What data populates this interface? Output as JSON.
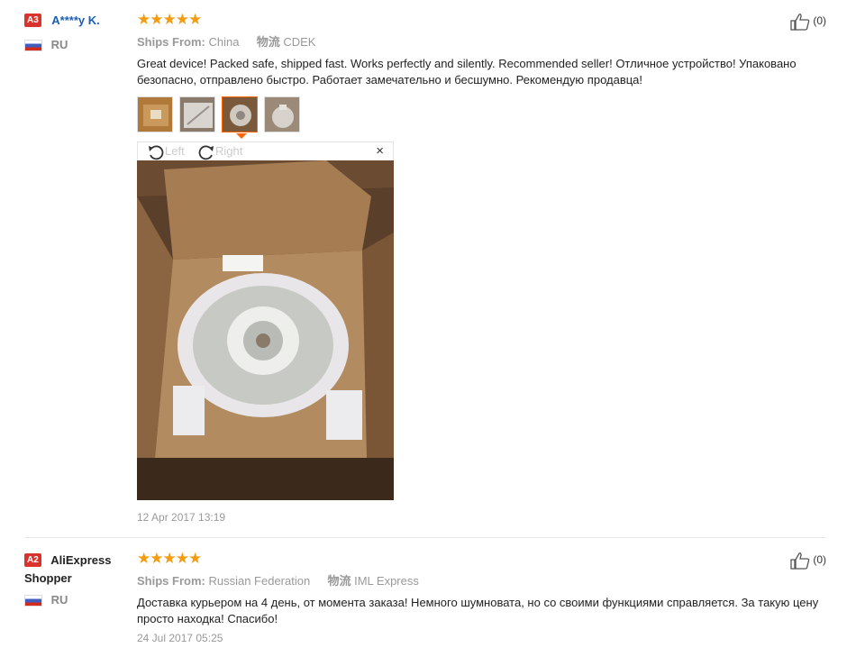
{
  "reviews": [
    {
      "level": "A3",
      "name": "A****y K.",
      "country": "RU",
      "stars": "★★★★★",
      "ships_from_label": "Ships From:",
      "ships_from_value": "China",
      "logistics_label": "物流",
      "logistics_value": "CDEK",
      "text": "Great device! Packed safe, shipped fast. Works perfectly and silently. Recommended seller! Отличное устройство! Упаковано безопасно, отправлено быстро. Работает замечательно и бесшумно. Рекомендую продавца!",
      "viewer": {
        "left_label": "Left",
        "right_label": "Right",
        "close": "×"
      },
      "date": "12 Apr 2017 13:19",
      "likes": "(0)"
    },
    {
      "level": "A2",
      "name": "AliExpress Shopper",
      "country": "RU",
      "stars": "★★★★★",
      "ships_from_label": "Ships From:",
      "ships_from_value": "Russian Federation",
      "logistics_label": "物流",
      "logistics_value": "IML Express",
      "text": "Доставка курьером на 4 день, от момента заказа! Немного шумновата, но со своими функциями справляется. За такую цену просто находка! Спасибо!",
      "date": "24 Jul 2017 05:25",
      "likes": "(0)"
    }
  ],
  "colors": {
    "star": "#f39c12",
    "badge": "#d9332e",
    "name_link": "#1a5fb4",
    "active_thumb": "#ff6600"
  }
}
